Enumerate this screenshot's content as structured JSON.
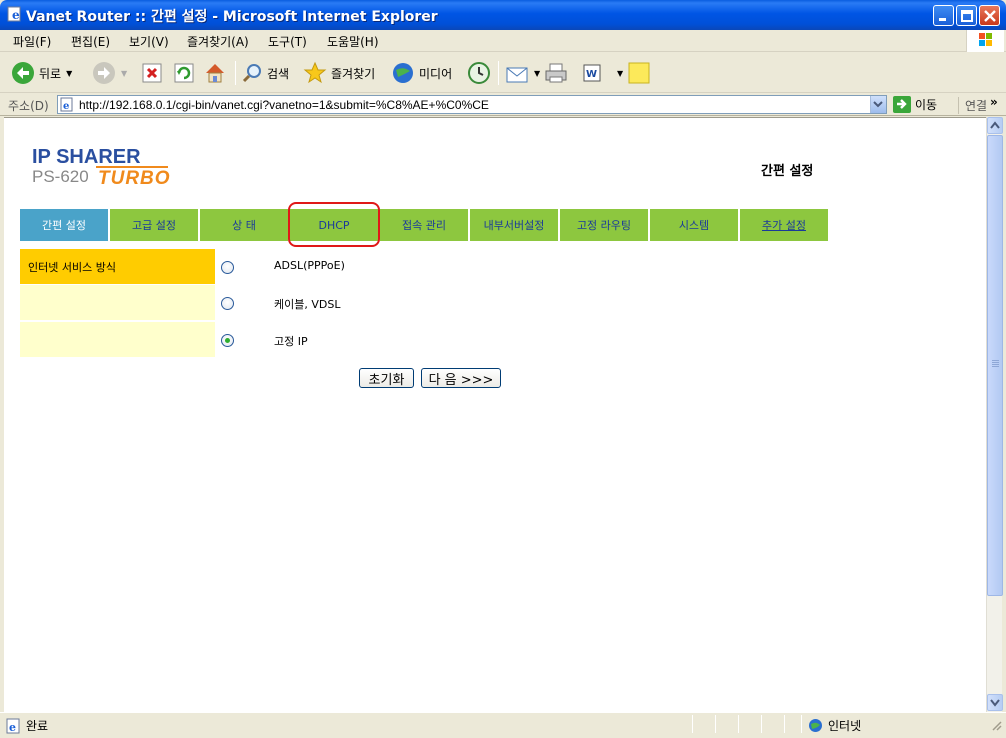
{
  "window": {
    "title": "Vanet Router :: 간편 설정 - Microsoft Internet Explorer"
  },
  "menu": [
    "파일(F)",
    "편집(E)",
    "보기(V)",
    "즐겨찾기(A)",
    "도구(T)",
    "도움말(H)"
  ],
  "toolbar": {
    "back": "뒤로",
    "search": "검색",
    "favorites": "즐겨찾기",
    "media": "미디어"
  },
  "address": {
    "label": "주소(D)",
    "url": "http://192.168.0.1/cgi-bin/vanet.cgi?vanetno=1&submit=%C8%AE+%C0%CE",
    "go": "이동",
    "links": "연결"
  },
  "page": {
    "logo": {
      "line1": "IP SHARER",
      "line2": "PS-620",
      "line3": "TURBO"
    },
    "heading": "간편 설정",
    "nav": [
      "간편 설정",
      "고급 설정",
      "상 태",
      "DHCP",
      "접속 관리",
      "내부서버설정",
      "고정 라우팅",
      "시스템",
      "추가 설정"
    ],
    "service_label": "인터넷 서비스 방식",
    "options": [
      "ADSL(PPPoE)",
      "케이블, VDSL",
      "고정 IP"
    ],
    "selected_option": "고정 IP",
    "buttons": {
      "reset": "초기화",
      "next": "다 음 >>>"
    }
  },
  "status": {
    "left": "완료",
    "zone": "인터넷"
  },
  "colors": {
    "nav": "#8dc73f",
    "nav_active": "#4aa3c9",
    "label_head": "#ffcc00",
    "label_bg": "#ffffcc",
    "highlight": "#e01818"
  }
}
